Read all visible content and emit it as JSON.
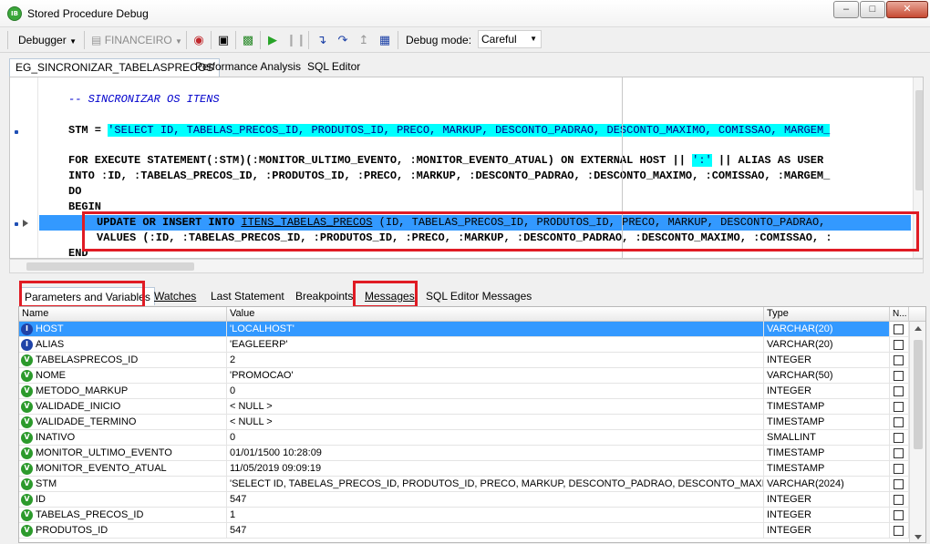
{
  "window": {
    "title": "Stored Procedure Debug"
  },
  "toolbar": {
    "debugger_label": "Debugger",
    "database_label": "FINANCEIRO",
    "debug_mode_label": "Debug mode:",
    "debug_mode_value": "Careful"
  },
  "editor_tabs": [
    "EG_SINCRONIZAR_TABELASPRECOS",
    "Performance Analysis",
    "SQL Editor"
  ],
  "code": {
    "comment": "-- SINCRONIZAR OS ITENS",
    "stm_assign": "STM = ",
    "stm_string": "'SELECT ID, TABELAS_PRECOS_ID, PRODUTOS_ID, PRECO, MARKUP, DESCONTO_PADRAO, DESCONTO_MAXIMO, COMISSAO, MARGEM_",
    "for_exec": "FOR EXECUTE STATEMENT(:STM)(:MONITOR_ULTIMO_EVENTO, :MONITOR_EVENTO_ATUAL) ON EXTERNAL HOST || ",
    "colon_str": "':'",
    "for_exec_tail": " || ALIAS AS USER",
    "into": "INTO :ID, :TABELAS_PRECOS_ID, :PRODUTOS_ID, :PRECO, :MARKUP, :DESCONTO_PADRAO, :DESCONTO_MAXIMO, :COMISSAO, :MARGEM_",
    "do": "DO",
    "begin": "BEGIN",
    "update_kw": "UPDATE OR INSERT INTO ",
    "update_table": "ITENS_TABELAS_PRECOS",
    "update_tail": " (ID, TABELAS_PRECOS_ID, PRODUTOS_ID, PRECO, MARKUP, DESCONTO_PADRAO,",
    "values": "VALUES (:ID, :TABELAS_PRECOS_ID, :PRODUTOS_ID, :PRECO, :MARKUP, :DESCONTO_PADRAO, :DESCONTO_MAXIMO, :COMISSAO, :",
    "end": "END"
  },
  "bottom_tabs": [
    "Parameters and Variables",
    "Watches",
    "Last Statement",
    "Breakpoints",
    "Messages",
    "SQL Editor Messages"
  ],
  "grid": {
    "columns": [
      "Name",
      "Value",
      "Type",
      "N..."
    ],
    "rows": [
      {
        "kind": "in",
        "name": "HOST",
        "value": "'LOCALHOST'",
        "type": "VARCHAR(20)"
      },
      {
        "kind": "in",
        "name": "ALIAS",
        "value": "'EAGLEERP'",
        "type": "VARCHAR(20)"
      },
      {
        "kind": "var",
        "name": "TABELASPRECOS_ID",
        "value": "2",
        "type": "INTEGER"
      },
      {
        "kind": "var",
        "name": "NOME",
        "value": "'PROMOCAO'",
        "type": "VARCHAR(50)"
      },
      {
        "kind": "var",
        "name": "METODO_MARKUP",
        "value": "0",
        "type": "INTEGER"
      },
      {
        "kind": "var",
        "name": "VALIDADE_INICIO",
        "value": "< NULL >",
        "type": "TIMESTAMP"
      },
      {
        "kind": "var",
        "name": "VALIDADE_TERMINO",
        "value": "< NULL >",
        "type": "TIMESTAMP"
      },
      {
        "kind": "var",
        "name": "INATIVO",
        "value": "0",
        "type": "SMALLINT"
      },
      {
        "kind": "var",
        "name": "MONITOR_ULTIMO_EVENTO",
        "value": "01/01/1500 10:28:09",
        "type": "TIMESTAMP"
      },
      {
        "kind": "var",
        "name": "MONITOR_EVENTO_ATUAL",
        "value": "11/05/2019 09:09:19",
        "type": "TIMESTAMP"
      },
      {
        "kind": "var",
        "name": "STM",
        "value": "'SELECT ID, TABELAS_PRECOS_ID, PRODUTOS_ID, PRECO, MARKUP, DESCONTO_PADRAO, DESCONTO_MAXIMO, C...",
        "type": "VARCHAR(2024)"
      },
      {
        "kind": "var",
        "name": "ID",
        "value": "547",
        "type": "INTEGER"
      },
      {
        "kind": "var",
        "name": "TABELAS_PRECOS_ID",
        "value": "1",
        "type": "INTEGER"
      },
      {
        "kind": "var",
        "name": "PRODUTOS_ID",
        "value": "547",
        "type": "INTEGER"
      }
    ]
  }
}
